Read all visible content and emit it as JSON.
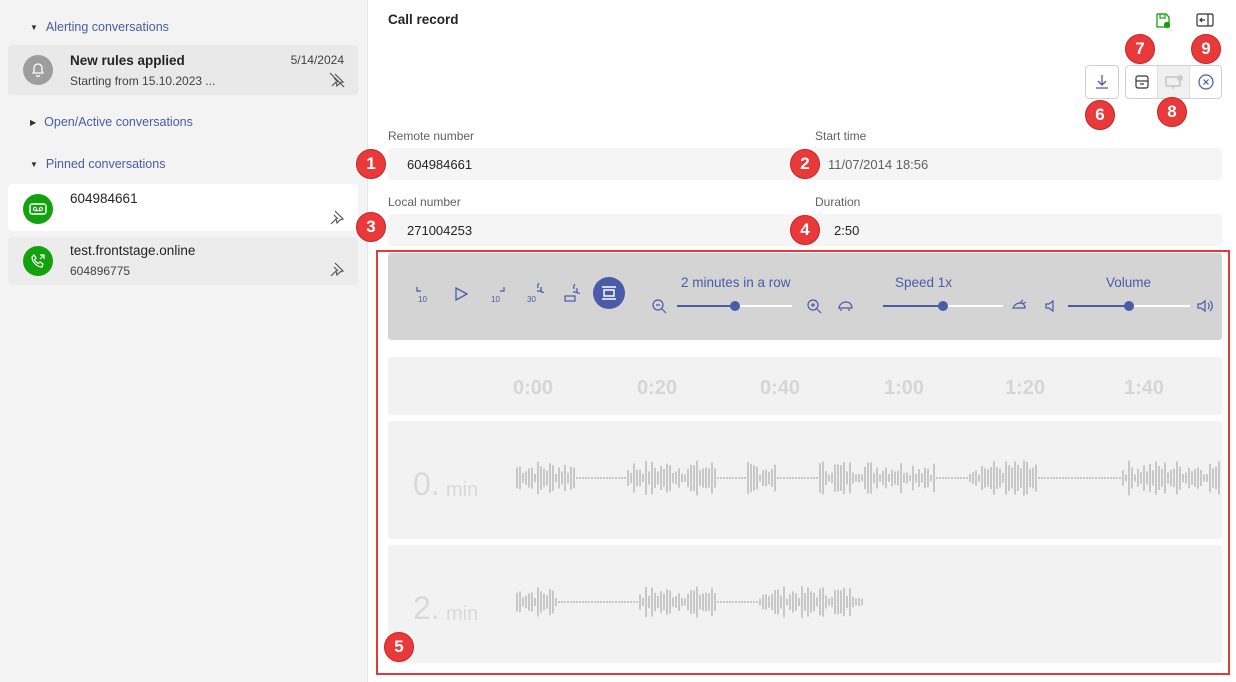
{
  "sidebar": {
    "sections": {
      "alerting": "Alerting conversations",
      "open": "Open/Active conversations",
      "pinned": "Pinned conversations"
    },
    "alert_card": {
      "title": "New rules applied",
      "subtitle": "Starting from 15.10.2023 ...",
      "date": "5/14/2024"
    },
    "pinned_cards": [
      {
        "title": "604984661",
        "subtitle": ""
      },
      {
        "title": "test.frontstage.online",
        "subtitle": "604896775"
      }
    ]
  },
  "main": {
    "title": "Call record",
    "fields": {
      "remote_label": "Remote number",
      "remote_value": "604984661",
      "start_label": "Start time",
      "start_value": "11/07/2014 18:56",
      "local_label": "Local number",
      "local_value": "271004253",
      "duration_label": "Duration",
      "duration_value": "2:50"
    },
    "player": {
      "skip_back": "10",
      "skip_fwd": "10",
      "skip_fwd30": "30",
      "zoom_label": "2 minutes in a row",
      "speed_label": "Speed 1x",
      "volume_label": "Volume",
      "zoom_level": 0.5,
      "speed_level": 0.5,
      "volume_level": 0.5
    },
    "timeline_ticks": [
      "0:00",
      "0:20",
      "0:40",
      "1:00",
      "1:20",
      "1:40"
    ],
    "wave_rows": [
      {
        "minute": "0.",
        "unit": "min"
      },
      {
        "minute": "2.",
        "unit": "min"
      }
    ]
  },
  "badges": [
    "1",
    "2",
    "3",
    "4",
    "5",
    "6",
    "7",
    "8",
    "9"
  ],
  "colors": {
    "accent": "#4a5ba8",
    "green": "#13a10e",
    "badge": "#e8393b"
  },
  "icons": [
    "bell-icon",
    "unpin-icon",
    "voicemail-icon",
    "phone-icon",
    "pin-icon",
    "save-icon",
    "collapse-panel-icon",
    "download-icon",
    "archive-icon",
    "screen-share-icon",
    "close-circle-icon"
  ]
}
